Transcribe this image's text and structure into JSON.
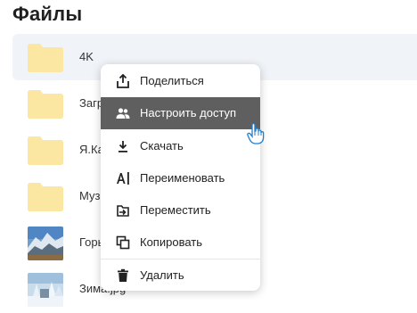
{
  "page": {
    "title": "Файлы"
  },
  "files": [
    {
      "name": "4K",
      "type": "folder"
    },
    {
      "name": "Загрузки",
      "type": "folder"
    },
    {
      "name": "Я.Картинки",
      "type": "folder"
    },
    {
      "name": "Музыка",
      "type": "folder"
    },
    {
      "name": "Горы.jpg",
      "type": "image"
    },
    {
      "name": "Зима.jpg",
      "type": "image"
    }
  ],
  "context_menu": {
    "items": [
      {
        "label": "Поделиться",
        "icon": "share-icon"
      },
      {
        "label": "Настроить доступ",
        "icon": "people-icon"
      },
      {
        "label": "Скачать",
        "icon": "download-icon"
      },
      {
        "label": "Переименовать",
        "icon": "rename-icon"
      },
      {
        "label": "Переместить",
        "icon": "move-icon"
      },
      {
        "label": "Копировать",
        "icon": "copy-icon"
      },
      {
        "label": "Удалить",
        "icon": "trash-icon"
      }
    ]
  },
  "colors": {
    "folder": "#fbe7a1",
    "highlight": "#5f5f5f",
    "cursor_blue": "#3aa0e8"
  }
}
